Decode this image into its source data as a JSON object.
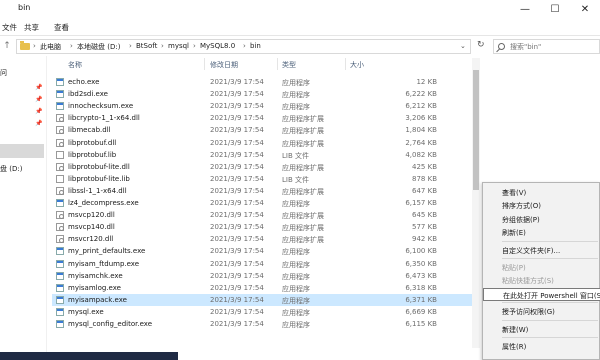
{
  "window": {
    "title": "bin",
    "controls": {
      "minimize": "—",
      "maximize": "☐",
      "close": "✕"
    }
  },
  "ribbon": {
    "tabs": [
      "文件",
      "共享",
      "查看"
    ]
  },
  "address": {
    "path": [
      "此电脑",
      "本地磁盘 (D:)",
      "BtSoft",
      "mysql",
      "MySQL8.0",
      "bin"
    ],
    "search_placeholder": "搜索\"bin\""
  },
  "nav": {
    "items": [
      "问",
      "盘 (D:)"
    ]
  },
  "columns": {
    "name": "名称",
    "date": "修改日期",
    "type": "类型",
    "size": "大小"
  },
  "files": [
    {
      "name": "echo.exe",
      "date": "2021/3/9 17:54",
      "type": "应用程序",
      "size": "12 KB",
      "kind": "exe"
    },
    {
      "name": "ibd2sdi.exe",
      "date": "2021/3/9 17:54",
      "type": "应用程序",
      "size": "6,222 KB",
      "kind": "exe"
    },
    {
      "name": "innochecksum.exe",
      "date": "2021/3/9 17:54",
      "type": "应用程序",
      "size": "6,212 KB",
      "kind": "exe"
    },
    {
      "name": "libcrypto-1_1-x64.dll",
      "date": "2021/3/9 17:54",
      "type": "应用程序扩展",
      "size": "3,206 KB",
      "kind": "dll"
    },
    {
      "name": "libmecab.dll",
      "date": "2021/3/9 17:54",
      "type": "应用程序扩展",
      "size": "1,804 KB",
      "kind": "dll"
    },
    {
      "name": "libprotobuf.dll",
      "date": "2021/3/9 17:54",
      "type": "应用程序扩展",
      "size": "2,764 KB",
      "kind": "dll"
    },
    {
      "name": "libprotobuf.lib",
      "date": "2021/3/9 17:54",
      "type": "LIB 文件",
      "size": "4,082 KB",
      "kind": "lib"
    },
    {
      "name": "libprotobuf-lite.dll",
      "date": "2021/3/9 17:54",
      "type": "应用程序扩展",
      "size": "425 KB",
      "kind": "dll"
    },
    {
      "name": "libprotobuf-lite.lib",
      "date": "2021/3/9 17:54",
      "type": "LIB 文件",
      "size": "878 KB",
      "kind": "lib"
    },
    {
      "name": "libssl-1_1-x64.dll",
      "date": "2021/3/9 17:54",
      "type": "应用程序扩展",
      "size": "647 KB",
      "kind": "dll"
    },
    {
      "name": "lz4_decompress.exe",
      "date": "2021/3/9 17:54",
      "type": "应用程序",
      "size": "6,157 KB",
      "kind": "exe"
    },
    {
      "name": "msvcp120.dll",
      "date": "2021/3/9 17:54",
      "type": "应用程序扩展",
      "size": "645 KB",
      "kind": "dll"
    },
    {
      "name": "msvcp140.dll",
      "date": "2021/3/9 17:54",
      "type": "应用程序扩展",
      "size": "577 KB",
      "kind": "dll"
    },
    {
      "name": "msvcr120.dll",
      "date": "2021/3/9 17:54",
      "type": "应用程序扩展",
      "size": "942 KB",
      "kind": "dll"
    },
    {
      "name": "my_print_defaults.exe",
      "date": "2021/3/9 17:54",
      "type": "应用程序",
      "size": "6,100 KB",
      "kind": "exe"
    },
    {
      "name": "myisam_ftdump.exe",
      "date": "2021/3/9 17:54",
      "type": "应用程序",
      "size": "6,350 KB",
      "kind": "exe"
    },
    {
      "name": "myisamchk.exe",
      "date": "2021/3/9 17:54",
      "type": "应用程序",
      "size": "6,473 KB",
      "kind": "exe"
    },
    {
      "name": "myisamlog.exe",
      "date": "2021/3/9 17:54",
      "type": "应用程序",
      "size": "6,318 KB",
      "kind": "exe"
    },
    {
      "name": "myisampack.exe",
      "date": "2021/3/9 17:54",
      "type": "应用程序",
      "size": "6,371 KB",
      "kind": "exe",
      "highlighted": true
    },
    {
      "name": "mysql.exe",
      "date": "2021/3/9 17:54",
      "type": "应用程序",
      "size": "6,669 KB",
      "kind": "exe"
    },
    {
      "name": "mysql_config_editor.exe",
      "date": "2021/3/9 17:54",
      "type": "应用程序",
      "size": "6,115 KB",
      "kind": "exe"
    }
  ],
  "context_menu": {
    "items": [
      {
        "label": "查看(V)",
        "arrow": ">",
        "disabled": false
      },
      {
        "label": "排序方式(O)",
        "arrow": ">",
        "disabled": false
      },
      {
        "label": "分组依据(P)",
        "arrow": ">",
        "disabled": false
      },
      {
        "label": "刷新(E)",
        "disabled": false
      },
      {
        "sep": true
      },
      {
        "label": "自定义文件夹(F)...",
        "disabled": false
      },
      {
        "sep": true
      },
      {
        "label": "粘贴(P)",
        "disabled": true
      },
      {
        "label": "粘贴快捷方式(S)",
        "disabled": true
      },
      {
        "label": "在此处打开 Powershell 窗口(S)",
        "disabled": false,
        "highlighted": true
      },
      {
        "sep": true
      },
      {
        "label": "授予访问权限(G)",
        "arrow": ">",
        "disabled": false
      },
      {
        "sep": true
      },
      {
        "label": "新建(W)",
        "arrow": ">",
        "disabled": false
      },
      {
        "sep": true
      },
      {
        "label": "属性(R)",
        "disabled": false
      }
    ]
  },
  "colors": {
    "row_highlight": "#cce8ff",
    "accent": "#3a7bd5",
    "menu_bg": "#f2f2f2"
  }
}
